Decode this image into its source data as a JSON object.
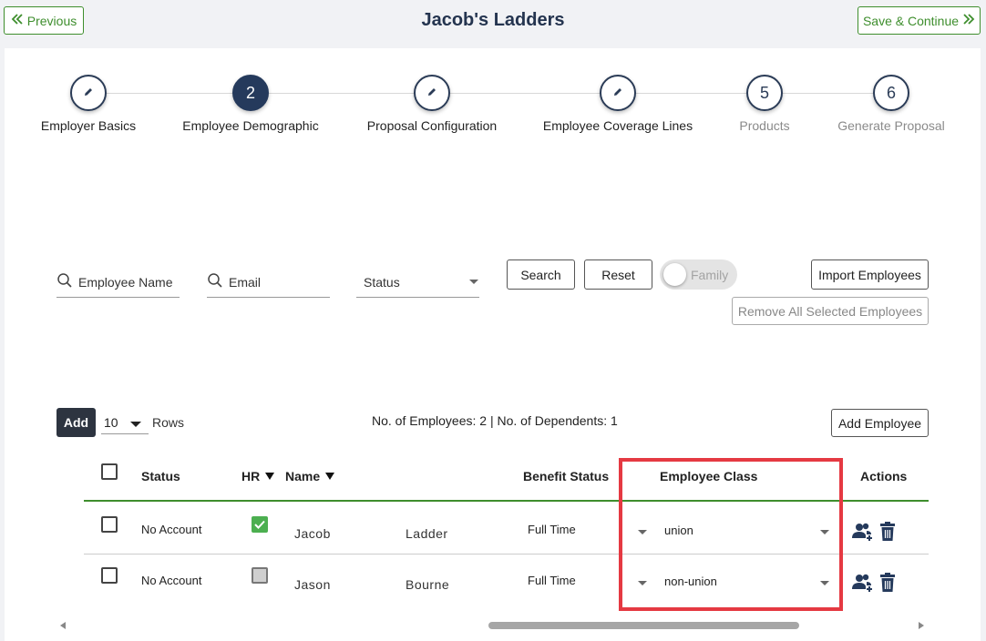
{
  "header": {
    "title": "Jacob's Ladders",
    "previous_label": "Previous",
    "save_label": "Save & Continue"
  },
  "steps": [
    {
      "number": "",
      "label": "Employer Basics",
      "state": "edit"
    },
    {
      "number": "2",
      "label": "Employee Demographic",
      "state": "active"
    },
    {
      "number": "",
      "label": "Proposal Configuration",
      "state": "edit"
    },
    {
      "number": "",
      "label": "Employee Coverage Lines",
      "state": "edit"
    },
    {
      "number": "5",
      "label": "Products",
      "state": "pending"
    },
    {
      "number": "6",
      "label": "Generate Proposal",
      "state": "pending"
    }
  ],
  "filters": {
    "name_placeholder": "Employee Name",
    "email_placeholder": "Email",
    "status_label": "Status",
    "search_label": "Search",
    "reset_label": "Reset",
    "family_label": "Family",
    "import_label": "Import Employees",
    "remove_all_label": "Remove All Selected Employees"
  },
  "table_controls": {
    "add_label": "Add",
    "rows_value": "10",
    "rows_label": "Rows",
    "summary": "No. of Employees: 2 | No. of Dependents: 1",
    "add_employee_label": "Add Employee"
  },
  "table": {
    "headers": {
      "status": "Status",
      "hr": "HR",
      "name": "Name",
      "benefit_status": "Benefit Status",
      "employee_class": "Employee Class",
      "actions": "Actions"
    },
    "rows": [
      {
        "status": "No Account",
        "hr": true,
        "first": "Jacob",
        "last": "Ladder",
        "benefit": "Full Time",
        "class": "union"
      },
      {
        "status": "No Account",
        "hr": false,
        "first": "Jason",
        "last": "Bourne",
        "benefit": "Full Time",
        "class": "non-union"
      }
    ]
  },
  "colors": {
    "accent_green": "#3e8e2d",
    "navy": "#253a5c",
    "highlight_red": "#e53942"
  }
}
